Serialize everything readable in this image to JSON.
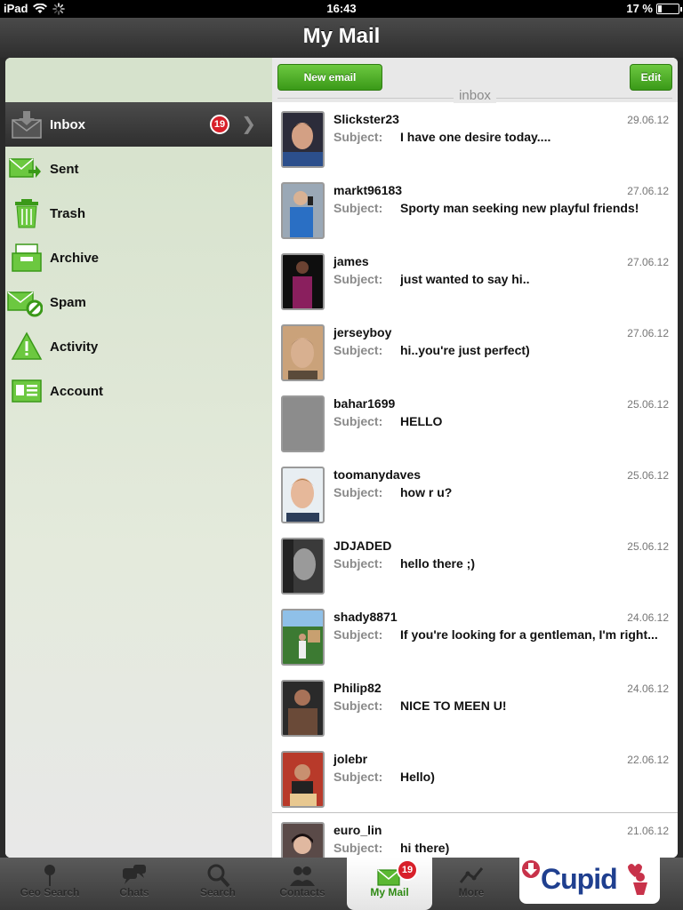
{
  "status_bar": {
    "device": "iPad",
    "time": "16:43",
    "battery_text": "17 %",
    "battery_level": 0.17
  },
  "header": {
    "title": "My Mail"
  },
  "sidebar": {
    "items": [
      {
        "label": "Inbox",
        "icon": "inbox-icon",
        "badge": "19",
        "active": true
      },
      {
        "label": "Sent",
        "icon": "sent-icon"
      },
      {
        "label": "Trash",
        "icon": "trash-icon"
      },
      {
        "label": "Archive",
        "icon": "archive-icon"
      },
      {
        "label": "Spam",
        "icon": "spam-icon"
      },
      {
        "label": "Activity",
        "icon": "warning-icon"
      },
      {
        "label": "Account",
        "icon": "account-card-icon"
      }
    ]
  },
  "toolbar": {
    "new_email_label": "New email",
    "edit_label": "Edit",
    "folder_label": "inbox"
  },
  "messages": {
    "subject_label": "Subject:",
    "items": [
      {
        "sender": "Slickster23",
        "date": "29.06.12",
        "subject": "I have one desire today...."
      },
      {
        "sender": "markt96183",
        "date": "27.06.12",
        "subject": "Sporty man seeking new playful friends!"
      },
      {
        "sender": "james",
        "date": "27.06.12",
        "subject": "just wanted to say hi.."
      },
      {
        "sender": "jerseyboy",
        "date": "27.06.12",
        "subject": "hi..you're just perfect)"
      },
      {
        "sender": "bahar1699",
        "date": "25.06.12",
        "subject": "HELLO"
      },
      {
        "sender": "toomanydaves",
        "date": "25.06.12",
        "subject": "how r u?"
      },
      {
        "sender": "JDJADED",
        "date": "25.06.12",
        "subject": "hello there ;)"
      },
      {
        "sender": "shady8871",
        "date": "24.06.12",
        "subject": "If you're looking for a gentleman, I'm right..."
      },
      {
        "sender": "Philip82",
        "date": "24.06.12",
        "subject": "NICE TO MEEN U!"
      },
      {
        "sender": "jolebr",
        "date": "22.06.12",
        "subject": "Hello)"
      },
      {
        "sender": "euro_lin",
        "date": "21.06.12",
        "subject": "hi there)"
      }
    ]
  },
  "tabbar": {
    "tabs": [
      {
        "label": "Geo Search",
        "icon": "map-pin-icon"
      },
      {
        "label": "Chats",
        "icon": "chat-bubbles-icon"
      },
      {
        "label": "Search",
        "icon": "magnifier-icon"
      },
      {
        "label": "Contacts",
        "icon": "contacts-icon"
      },
      {
        "label": "My Mail",
        "icon": "envelope-icon",
        "badge": "19",
        "active": true
      },
      {
        "label": "More",
        "icon": "more-chart-icon"
      }
    ],
    "logo_text": "Cupid"
  },
  "colors": {
    "accent_green": "#3a9918",
    "badge_red": "#d8202a",
    "logo_blue": "#1f3f8f"
  }
}
